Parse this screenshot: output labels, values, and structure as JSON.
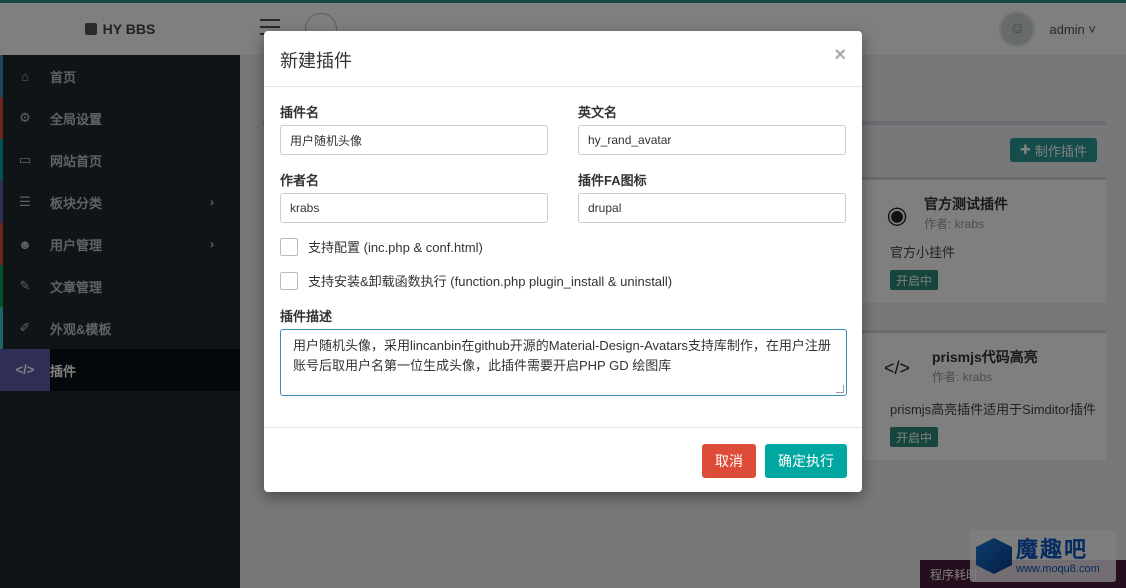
{
  "app": {
    "brand": "HY BBS",
    "user": "admin ˅",
    "sidebar": [
      {
        "icon": "home-icon",
        "glyph": "⌂",
        "label": "首页",
        "color": "#3c8dbc",
        "arrow": ""
      },
      {
        "icon": "gear-icon",
        "glyph": "⚙",
        "label": "全局设置",
        "color": "#dd4b39",
        "arrow": ""
      },
      {
        "icon": "monitor-icon",
        "glyph": "▭",
        "label": "网站首页",
        "color": "#00a7a0",
        "arrow": ""
      },
      {
        "icon": "list-icon",
        "glyph": "☰",
        "label": "板块分类",
        "color": "#605ca8",
        "arrow": "›"
      },
      {
        "icon": "users-icon",
        "glyph": "☻",
        "label": "用户管理",
        "color": "#dd4b39",
        "arrow": "›"
      },
      {
        "icon": "tags-icon",
        "glyph": "✎",
        "label": "文章管理",
        "color": "#00a65a",
        "arrow": ""
      },
      {
        "icon": "brush-icon",
        "glyph": "✐",
        "label": "外观&模板",
        "color": "#39cccc",
        "arrow": ""
      },
      {
        "icon": "code-icon",
        "glyph": "</>",
        "label": "插件",
        "color": "#605ca8",
        "arrow": "",
        "active": true
      }
    ],
    "make_plugin": "制作插件",
    "plugins": [
      {
        "icon": "github-icon",
        "glyph": "◉",
        "title": "官方测试插件",
        "author": "作者: krabs",
        "desc": "官方小挂件",
        "status": "开启中"
      },
      {
        "icon": "code-icon",
        "glyph": "</>",
        "title": "prismjs代码高亮",
        "author": "作者: krabs",
        "desc": "prismjs高亮插件适用于Simditor插件",
        "status": "开启中"
      }
    ],
    "footer": "程序耗时",
    "watermark": {
      "title": "魔趣吧",
      "url": "www.moqu8.com"
    }
  },
  "modal": {
    "title": "新建插件",
    "close": "×",
    "fields": {
      "name_label": "插件名",
      "name_value": "用户随机头像",
      "en_label": "英文名",
      "en_value": "hy_rand_avatar",
      "author_label": "作者名",
      "author_value": "krabs",
      "fa_label": "插件FA图标",
      "fa_value": "drupal"
    },
    "checks": {
      "config": "支持配置 (inc.php & conf.html)",
      "install": "支持安装&卸载函数执行 (function.php plugin_install & uninstall)"
    },
    "desc_label": "插件描述",
    "desc_value": "用户随机头像，采用lincanbin在github开源的Material-Design-Avatars支持库制作，在用户注册账号后取用户名第一位生成头像，此插件需要开启PHP GD 绘图库",
    "cancel": "取消",
    "confirm": "确定执行"
  }
}
